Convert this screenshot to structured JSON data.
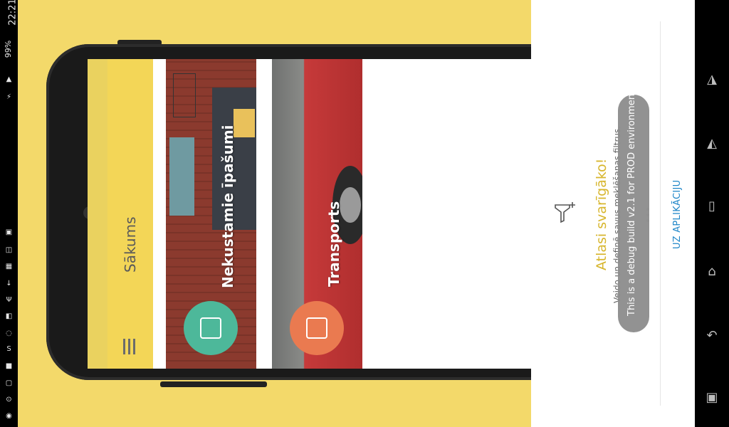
{
  "status_bar": {
    "time": "22:21",
    "battery": "99%",
    "icons": [
      "charging-icon",
      "signal-icon",
      "alarm-icon",
      "messenger-icon",
      "skype-icon",
      "gallery-icon",
      "download-icon",
      "notification-icon"
    ]
  },
  "app": {
    "title": "Sākums",
    "cards": [
      {
        "label": "Nekustamie īpašumi",
        "icon": "house-icon",
        "accent": "#4db89a"
      },
      {
        "label": "Transports",
        "icon": "car-icon",
        "accent": "#ea7a50"
      }
    ]
  },
  "onboarding": {
    "title": "Atlasi svarīgāko!",
    "description": "Veido un definē savus meklēšanas filtrus.",
    "toast": "This is a debug build v2.1 for PROD environment",
    "cta": "UZ APLIKĀCIJU",
    "icon": "filter-plus-icon"
  },
  "nav": {
    "buttons": [
      "screenshot-icon",
      "back-icon",
      "home-icon",
      "recents-icon",
      "flashlight-icon",
      "flashlight-on-icon"
    ]
  },
  "colors": {
    "background_yellow": "#f3d96a",
    "appbar_yellow": "#f3d657",
    "title_gold": "#d7b62e",
    "link_blue": "#1f86c8"
  }
}
